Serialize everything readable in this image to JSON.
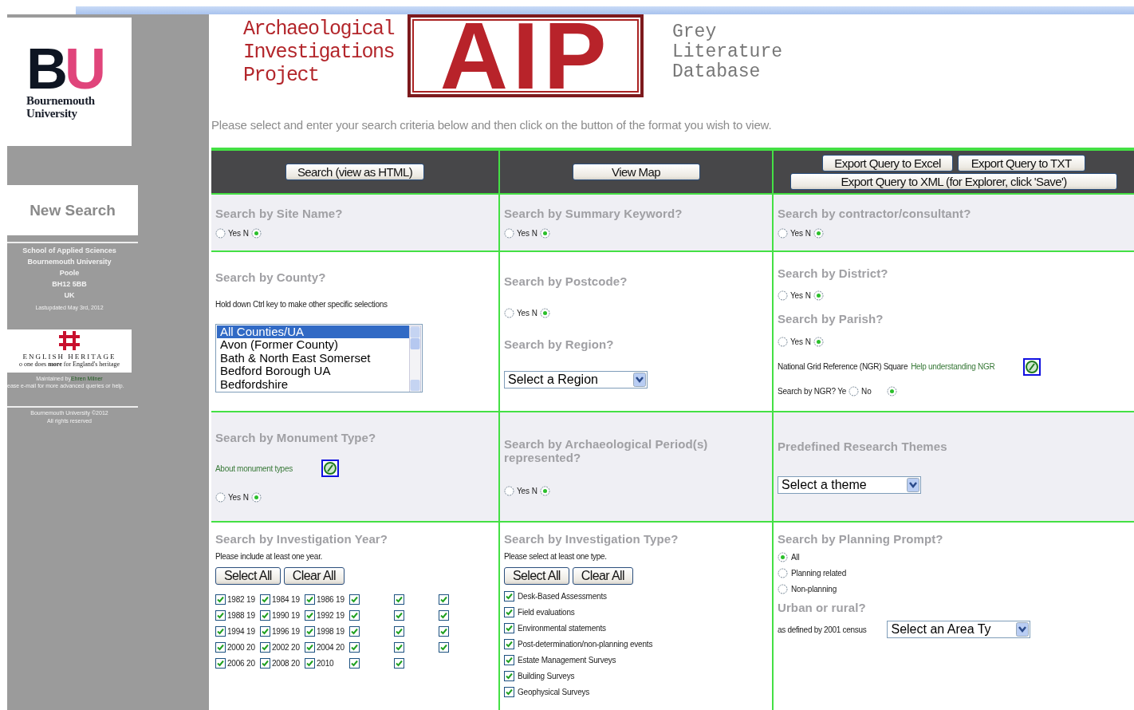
{
  "sidebar": {
    "logo": {
      "mark": "BU",
      "name": [
        "Bournemouth",
        "University"
      ]
    },
    "new_search": "New Search",
    "address": [
      "School of Applied Sciences",
      "Bournemouth University",
      "Poole",
      "BH12 5BB",
      "UK"
    ],
    "last_updated": "Lastupdated May 3rd, 2012",
    "partner_logo": {
      "name": "ENGLISH HERITAGE",
      "tagline": "o one does **more** for England's heritage"
    },
    "maintained_by": {
      "text": "Maintained by",
      "link": "Ehren Milner"
    },
    "help_note": "ease e-mail for more advanced queries or help.",
    "copyright": [
      "Bournemouth University ©2012",
      "All rights reserved"
    ]
  },
  "header": {
    "project_title": [
      "Archaeological",
      "Investigations",
      "Project"
    ],
    "logo": "AIP",
    "subtitle": [
      "Grey",
      "Literature",
      "Database"
    ],
    "instructions": "Please select and enter your search criteria below and then click on the button of the format you wish to view."
  },
  "actions": [
    [
      "Search (view as HTML)"
    ],
    [
      "View Map"
    ],
    [
      "Export Query to Excel",
      "Export Query to TXT",
      "Export Query to XML (for Explorer, click 'Save')"
    ]
  ],
  "rows": [
    {
      "shaded": true,
      "cells": [
        [
          {
            "kind": "heading",
            "text": "Search by Site Name?"
          },
          {
            "kind": "yes_no",
            "yes": {
              "label": "Yes",
              "selected": false
            },
            "no": {
              "label": "N",
              "selected": true
            }
          }
        ],
        [
          {
            "kind": "heading",
            "text": "Search by Summary Keyword?"
          },
          {
            "kind": "yes_no",
            "yes": {
              "label": "Yes",
              "selected": false
            },
            "no": {
              "label": "N",
              "selected": true
            }
          }
        ],
        [
          {
            "kind": "heading",
            "text": "Search by contractor/consultant?"
          },
          {
            "kind": "yes_no",
            "yes": {
              "label": "Yes",
              "selected": false
            },
            "no": {
              "label": "N",
              "selected": true
            }
          }
        ]
      ]
    },
    {
      "shaded": false,
      "cells": [
        [
          {
            "kind": "heading",
            "text": "Search by County?"
          },
          {
            "kind": "note",
            "text": "Hold down Ctrl key to make other specific selections"
          },
          {
            "kind": "listbox",
            "options": [
              {
                "label": "All Counties/UA",
                "selected": true
              },
              {
                "label": "Avon (Former County)",
                "selected": false
              },
              {
                "label": "Bath & North East Somerset",
                "selected": false
              },
              {
                "label": "Bedford Borough UA",
                "selected": false
              },
              {
                "label": "Bedfordshire",
                "selected": false
              }
            ]
          }
        ],
        [
          {
            "kind": "heading",
            "text": "Search by Postcode?"
          },
          {
            "kind": "yes_no",
            "yes": {
              "label": "Yes",
              "selected": false
            },
            "no": {
              "label": "N",
              "selected": true
            }
          },
          {
            "kind": "heading",
            "text": "Search by Region?"
          },
          {
            "kind": "dropdown",
            "value": "Select a Region"
          }
        ],
        [
          {
            "kind": "heading",
            "text": "Search by District?"
          },
          {
            "kind": "yes_no",
            "yes": {
              "label": "Yes",
              "selected": false
            },
            "no": {
              "label": "N",
              "selected": true
            }
          },
          {
            "kind": "heading",
            "text": "Search by Parish?"
          },
          {
            "kind": "yes_no",
            "yes": {
              "label": "Yes",
              "selected": false
            },
            "no": {
              "label": "N",
              "selected": true
            }
          },
          {
            "kind": "help_link",
            "text": "National Grid Reference (NGR) Square",
            "link": "Help understanding NGR"
          },
          {
            "kind": "ngr_choice",
            "prompt": "Search by NGR? Ye",
            "yes": {
              "selected": false
            },
            "no": {
              "label": "No",
              "selected": true
            }
          }
        ]
      ]
    },
    {
      "shaded": true,
      "cells": [
        [
          {
            "kind": "heading",
            "text": "Search by Monument Type?"
          },
          {
            "kind": "help_link",
            "link": "About monument types"
          },
          {
            "kind": "yes_no",
            "yes": {
              "label": "Yes",
              "selected": false
            },
            "no": {
              "label": "N",
              "selected": true
            }
          }
        ],
        [
          {
            "kind": "heading",
            "text": "Search by Archaeological Period(s) represented?"
          },
          {
            "kind": "yes_no",
            "yes": {
              "label": "Yes",
              "selected": false
            },
            "no": {
              "label": "N",
              "selected": true
            }
          }
        ],
        [
          {
            "kind": "heading",
            "text": "Predefined Research Themes"
          },
          {
            "kind": "dropdown",
            "value": "Select a theme"
          }
        ]
      ]
    },
    {
      "shaded": false,
      "cells": [
        [
          {
            "kind": "heading",
            "text": "Search by Investigation Year?"
          },
          {
            "kind": "note",
            "text": "Please include at least one year."
          },
          {
            "kind": "buttons",
            "labels": [
              "Select All",
              "Clear All"
            ]
          },
          {
            "kind": "checkbox_grid",
            "rows": [
              [
                {
                  "label": "1982 19",
                  "checked": true
                },
                {
                  "label": "1984 19",
                  "checked": true
                },
                {
                  "label": "1986 19",
                  "checked": true
                },
                {
                  "checked": true
                },
                {
                  "checked": true
                },
                {
                  "checked": true
                }
              ],
              [
                {
                  "label": "1988 19",
                  "checked": true
                },
                {
                  "label": "1990 19",
                  "checked": true
                },
                {
                  "label": "1992 19",
                  "checked": true
                },
                {
                  "checked": true
                },
                {
                  "checked": true
                },
                {
                  "checked": true
                }
              ],
              [
                {
                  "label": "1994 19",
                  "checked": true
                },
                {
                  "label": "1996 19",
                  "checked": true
                },
                {
                  "label": "1998 19",
                  "checked": true
                },
                {
                  "checked": true
                },
                {
                  "checked": true
                },
                {
                  "checked": true
                }
              ],
              [
                {
                  "label": "2000 20",
                  "checked": true
                },
                {
                  "label": "2002 20",
                  "checked": true
                },
                {
                  "label": "2004 20",
                  "checked": true
                },
                {
                  "checked": true
                },
                {
                  "checked": true
                },
                {
                  "checked": true
                }
              ],
              [
                {
                  "label": "2006 20",
                  "checked": true
                },
                {
                  "label": "2008 20",
                  "checked": true
                },
                {
                  "label": "2010",
                  "checked": true
                },
                {
                  "checked": true
                },
                {
                  "checked": true
                }
              ]
            ]
          }
        ],
        [
          {
            "kind": "heading",
            "text": "Search by Investigation Type?"
          },
          {
            "kind": "note",
            "text": "Please select at least one type."
          },
          {
            "kind": "buttons",
            "labels": [
              "Select All",
              "Clear All"
            ]
          },
          {
            "kind": "checkbox_list",
            "items": [
              {
                "label": "Desk-Based Assessments",
                "checked": true
              },
              {
                "label": "Field evaluations",
                "checked": true
              },
              {
                "label": "Environmental statements",
                "checked": true
              },
              {
                "label": "Post-determination/non-planning events",
                "checked": true
              },
              {
                "label": "Estate Management Surveys",
                "checked": true
              },
              {
                "label": "Building Surveys",
                "checked": true
              },
              {
                "label": "Geophysical Surveys",
                "checked": true
              }
            ]
          }
        ],
        [
          {
            "kind": "heading",
            "text": "Search by Planning Prompt?"
          },
          {
            "kind": "radio_list",
            "items": [
              {
                "label": "All",
                "selected": true
              },
              {
                "label": "Planning related",
                "selected": false
              },
              {
                "label": "Non-planning",
                "selected": false
              }
            ]
          },
          {
            "kind": "heading",
            "text": "Urban or rural?"
          },
          {
            "kind": "dropdown",
            "caption": "as defined by 2001 census",
            "value": "Select an Area Ty"
          }
        ]
      ]
    }
  ]
}
